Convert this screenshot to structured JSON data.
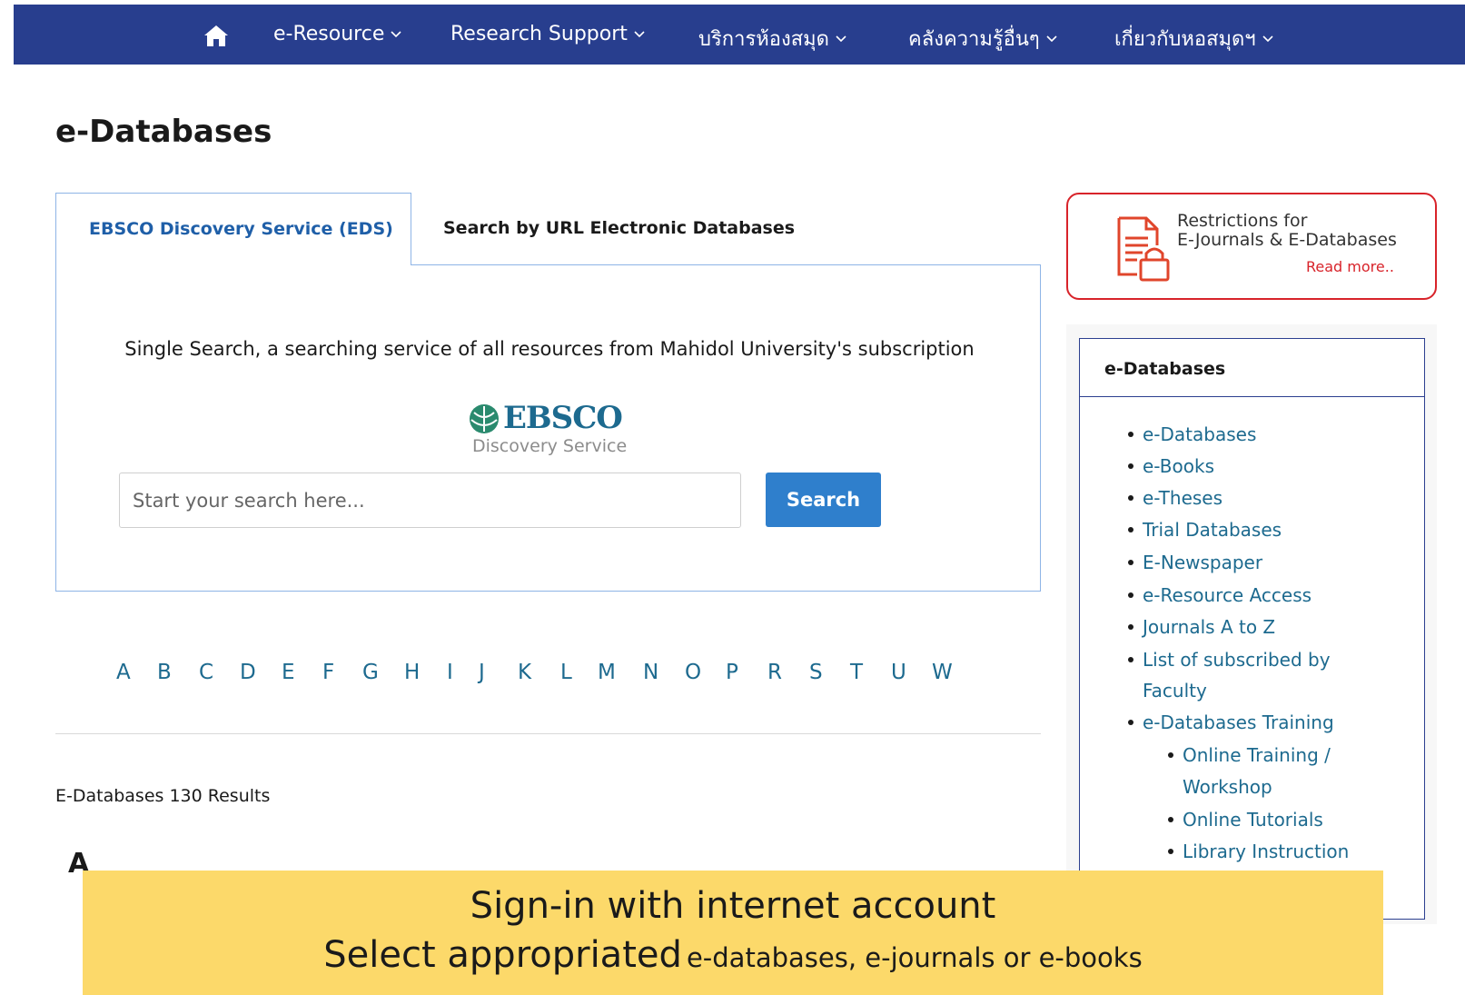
{
  "nav": {
    "home_icon": "home-icon",
    "items": [
      {
        "label": "e-Resource"
      },
      {
        "label": "Research Support"
      },
      {
        "label": "บริการห้องสมุด"
      },
      {
        "label": "คลังความรู้อื่นๆ"
      },
      {
        "label": "เกี่ยวกับหอสมุดฯ"
      }
    ],
    "bg_color": "#283e8e"
  },
  "page_title": "e-Databases",
  "tabs": [
    {
      "label": "EBSCO Discovery Service (EDS)",
      "active": true
    },
    {
      "label": "Search by URL Electronic Databases",
      "active": false
    }
  ],
  "eds": {
    "description": "Single Search, a searching service of all resources from Mahidol University's subscription",
    "logo_word": "EBSCO",
    "logo_sub": "Discovery Service",
    "search_placeholder": "Start your search here...",
    "search_button": "Search"
  },
  "alphabet": [
    "A",
    "B",
    "C",
    "D",
    "E",
    "F",
    "G",
    "H",
    "I",
    "J",
    "K",
    "L",
    "M",
    "N",
    "O",
    "P",
    "R",
    "S",
    "T",
    "U",
    "W"
  ],
  "results_text": "E-Databases 130 Results",
  "letter_heading": "A",
  "restrictions": {
    "title_line1": "Restrictions for",
    "title_line2": "E-Journals & E-Databases",
    "read_more": "Read more.."
  },
  "sidebar": {
    "heading": "e-Databases",
    "items": [
      {
        "label": "e-Databases"
      },
      {
        "label": "e-Books"
      },
      {
        "label": "e-Theses"
      },
      {
        "label": "Trial Databases"
      },
      {
        "label": "E-Newspaper"
      },
      {
        "label": "e-Resource Access"
      },
      {
        "label": "Journals A to Z"
      },
      {
        "label": "List of subscribed by"
      },
      {
        "label": "Faculty"
      },
      {
        "label": "e-Databases Training"
      }
    ],
    "subitems": [
      {
        "label": "Online Training /"
      },
      {
        "label": "Workshop"
      },
      {
        "label": "Online Tutorials"
      },
      {
        "label": "Library Instruction"
      }
    ]
  },
  "banner": {
    "line1": "Sign-in with internet account",
    "line2_big": "Select appropriated",
    "line2_small": "e-databases, e-journals or e-books"
  }
}
